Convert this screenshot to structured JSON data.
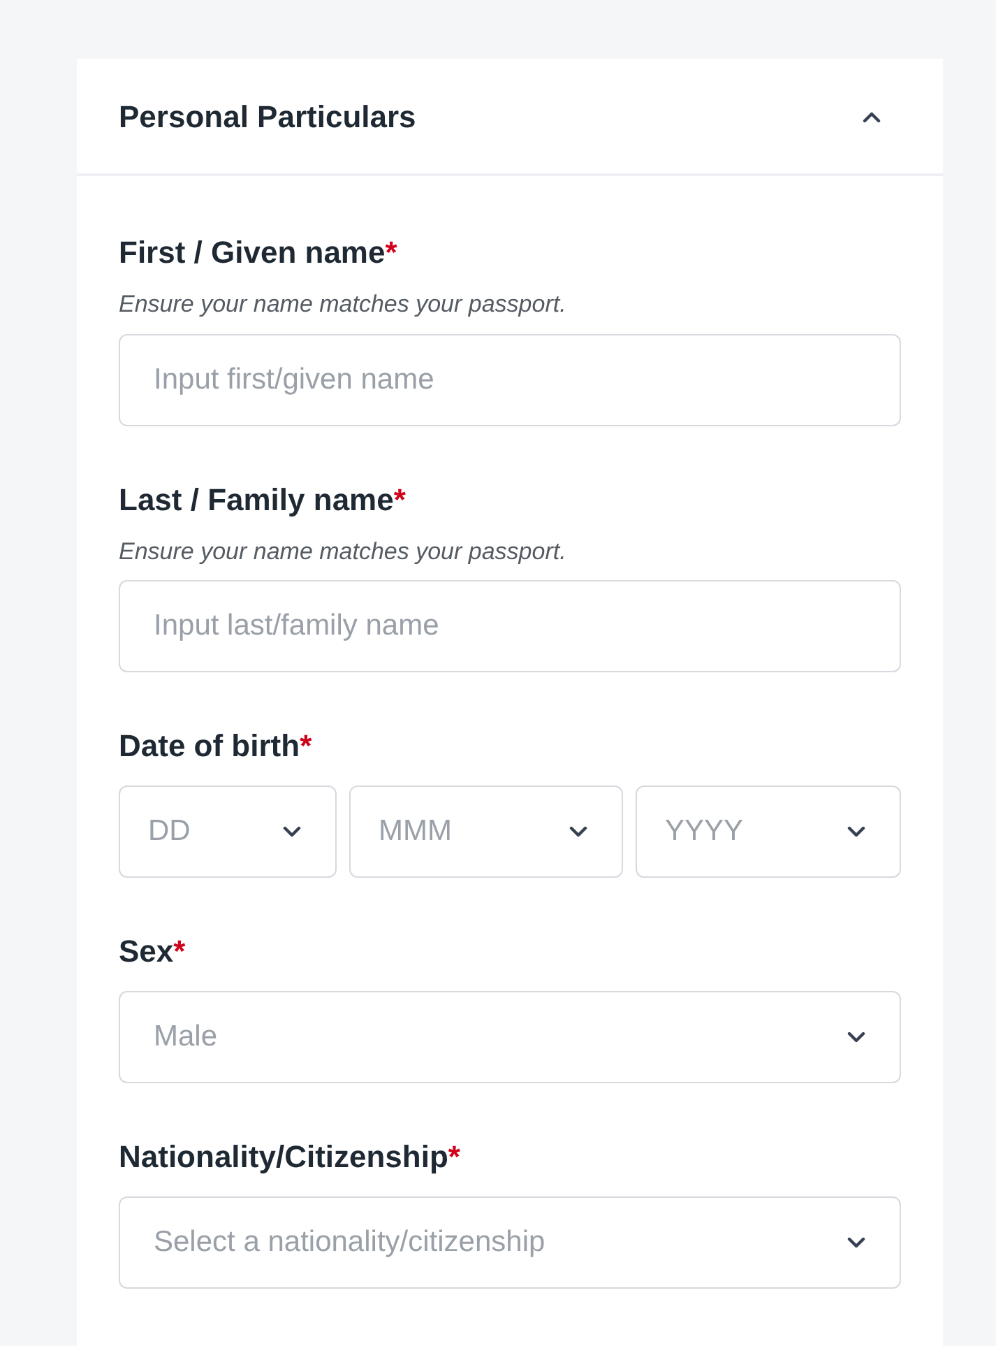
{
  "section": {
    "title": "Personal Particulars",
    "expanded": true
  },
  "fields": [
    {
      "kind": "text",
      "label": "First / Given name",
      "required_mark": "*",
      "hint": "Ensure your name matches your passport.",
      "placeholder": "Input first/given name"
    },
    {
      "kind": "text",
      "label": "Last / Family name",
      "required_mark": "*",
      "hint": "Ensure your name matches your passport.",
      "placeholder": "Input last/family name"
    },
    {
      "kind": "date",
      "label": "Date of birth",
      "required_mark": "*",
      "parts": [
        {
          "placeholder": "DD"
        },
        {
          "placeholder": "MMM"
        },
        {
          "placeholder": "YYYY"
        }
      ]
    },
    {
      "kind": "select",
      "label": "Sex",
      "required_mark": "*",
      "placeholder": "Male"
    },
    {
      "kind": "select",
      "label": "Nationality/Citizenship",
      "required_mark": "*",
      "placeholder": "Select a nationality/citizenship"
    }
  ]
}
